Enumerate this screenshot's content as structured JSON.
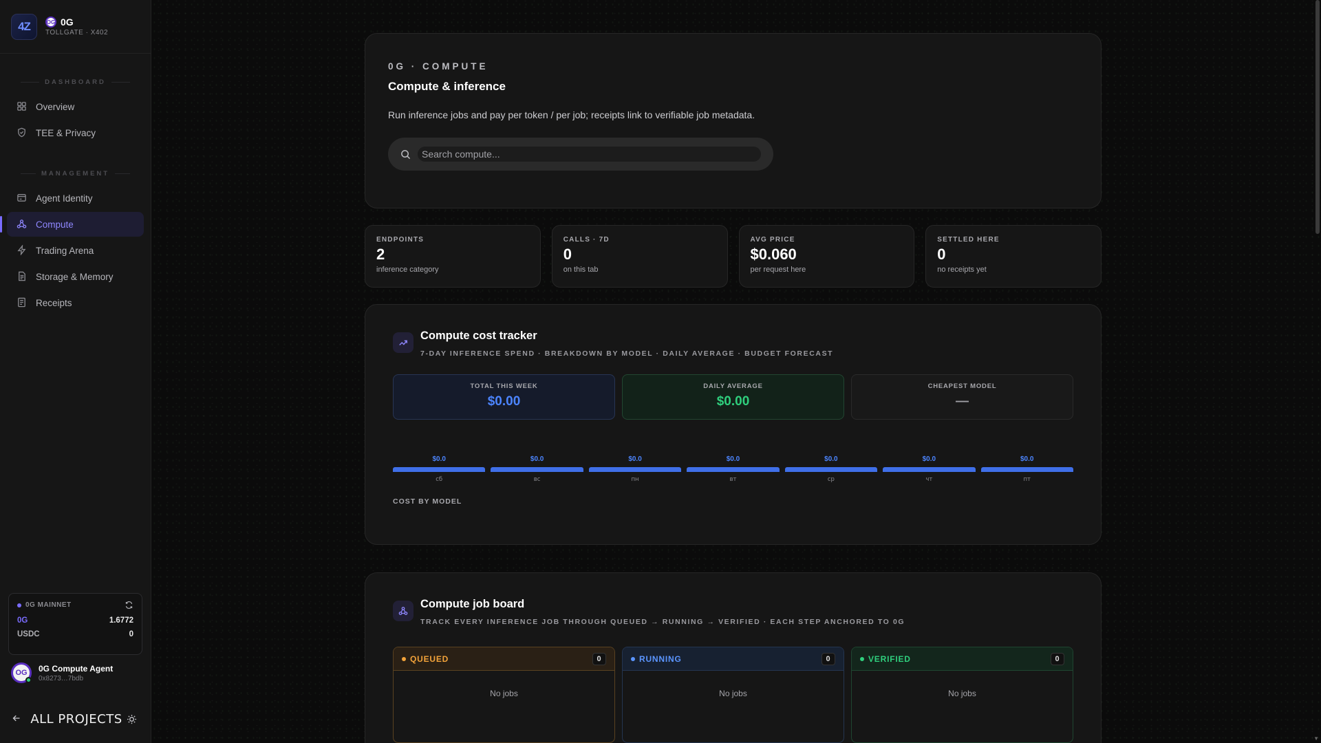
{
  "brand": {
    "logo": "4Z",
    "badge": "OG",
    "name": "0G",
    "subtitle": "TOLLGATE · X402"
  },
  "sidebar": {
    "sections": [
      {
        "title": "DASHBOARD",
        "items": [
          {
            "label": "Overview",
            "icon": "grid-icon"
          },
          {
            "label": "TEE & Privacy",
            "icon": "shield-icon"
          }
        ]
      },
      {
        "title": "MANAGEMENT",
        "items": [
          {
            "label": "Agent Identity",
            "icon": "id-card-icon"
          },
          {
            "label": "Compute",
            "icon": "network-icon",
            "active": true
          },
          {
            "label": "Trading Arena",
            "icon": "lightning-icon"
          },
          {
            "label": "Storage & Memory",
            "icon": "document-icon"
          },
          {
            "label": "Receipts",
            "icon": "receipt-icon"
          }
        ]
      }
    ]
  },
  "wallet": {
    "network": "0G MAINNET",
    "rows": [
      {
        "token": "0G",
        "amount": "1.6772"
      },
      {
        "token": "USDC",
        "amount": "0"
      }
    ]
  },
  "agent": {
    "avatar": "OG",
    "name": "0G Compute Agent",
    "address": "0x8273…7bdb"
  },
  "footer": {
    "all_projects": "ALL PROJECTS"
  },
  "hero": {
    "eyebrow": "0G · COMPUTE",
    "title": "Compute & inference",
    "description": "Run inference jobs and pay per token / per job; receipts link to verifiable job metadata.",
    "search_placeholder": "Search compute..."
  },
  "stats": [
    {
      "label": "ENDPOINTS",
      "value": "2",
      "sub": "inference category"
    },
    {
      "label": "CALLS · 7D",
      "value": "0",
      "sub": "on this tab"
    },
    {
      "label": "AVG PRICE",
      "value": "$0.060",
      "sub": "per request here"
    },
    {
      "label": "SETTLED HERE",
      "value": "0",
      "sub": "no receipts yet"
    }
  ],
  "tracker": {
    "title": "Compute cost tracker",
    "subtitle": "7-DAY INFERENCE SPEND · BREAKDOWN BY MODEL · DAILY AVERAGE · BUDGET FORECAST",
    "metrics": [
      {
        "label": "TOTAL THIS WEEK",
        "value": "$0.00",
        "tone": "blue"
      },
      {
        "label": "DAILY AVERAGE",
        "value": "$0.00",
        "tone": "green"
      },
      {
        "label": "CHEAPEST MODEL",
        "value": "—",
        "tone": "gray"
      }
    ],
    "days": [
      {
        "value": "$0.0",
        "label": "сб"
      },
      {
        "value": "$0.0",
        "label": "вс"
      },
      {
        "value": "$0.0",
        "label": "пн"
      },
      {
        "value": "$0.0",
        "label": "вт"
      },
      {
        "value": "$0.0",
        "label": "ср"
      },
      {
        "value": "$0.0",
        "label": "чт"
      },
      {
        "value": "$0.0",
        "label": "пт"
      }
    ],
    "cost_by_model": "COST BY MODEL"
  },
  "board": {
    "title": "Compute job board",
    "subtitle": "TRACK EVERY INFERENCE JOB THROUGH QUEUED → RUNNING → VERIFIED · EACH STEP ANCHORED TO 0G",
    "columns": [
      {
        "label": "QUEUED",
        "count": "0",
        "empty": "No jobs",
        "color": "#f3a33a"
      },
      {
        "label": "RUNNING",
        "count": "0",
        "empty": "No jobs",
        "color": "#5b95ff"
      },
      {
        "label": "VERIFIED",
        "count": "0",
        "empty": "No jobs",
        "color": "#2fcf7d"
      }
    ]
  },
  "colors": {
    "accent": "#7a6cff",
    "blue": "#4c85ff",
    "green": "#2fcf7d",
    "amber": "#f3a33a"
  }
}
